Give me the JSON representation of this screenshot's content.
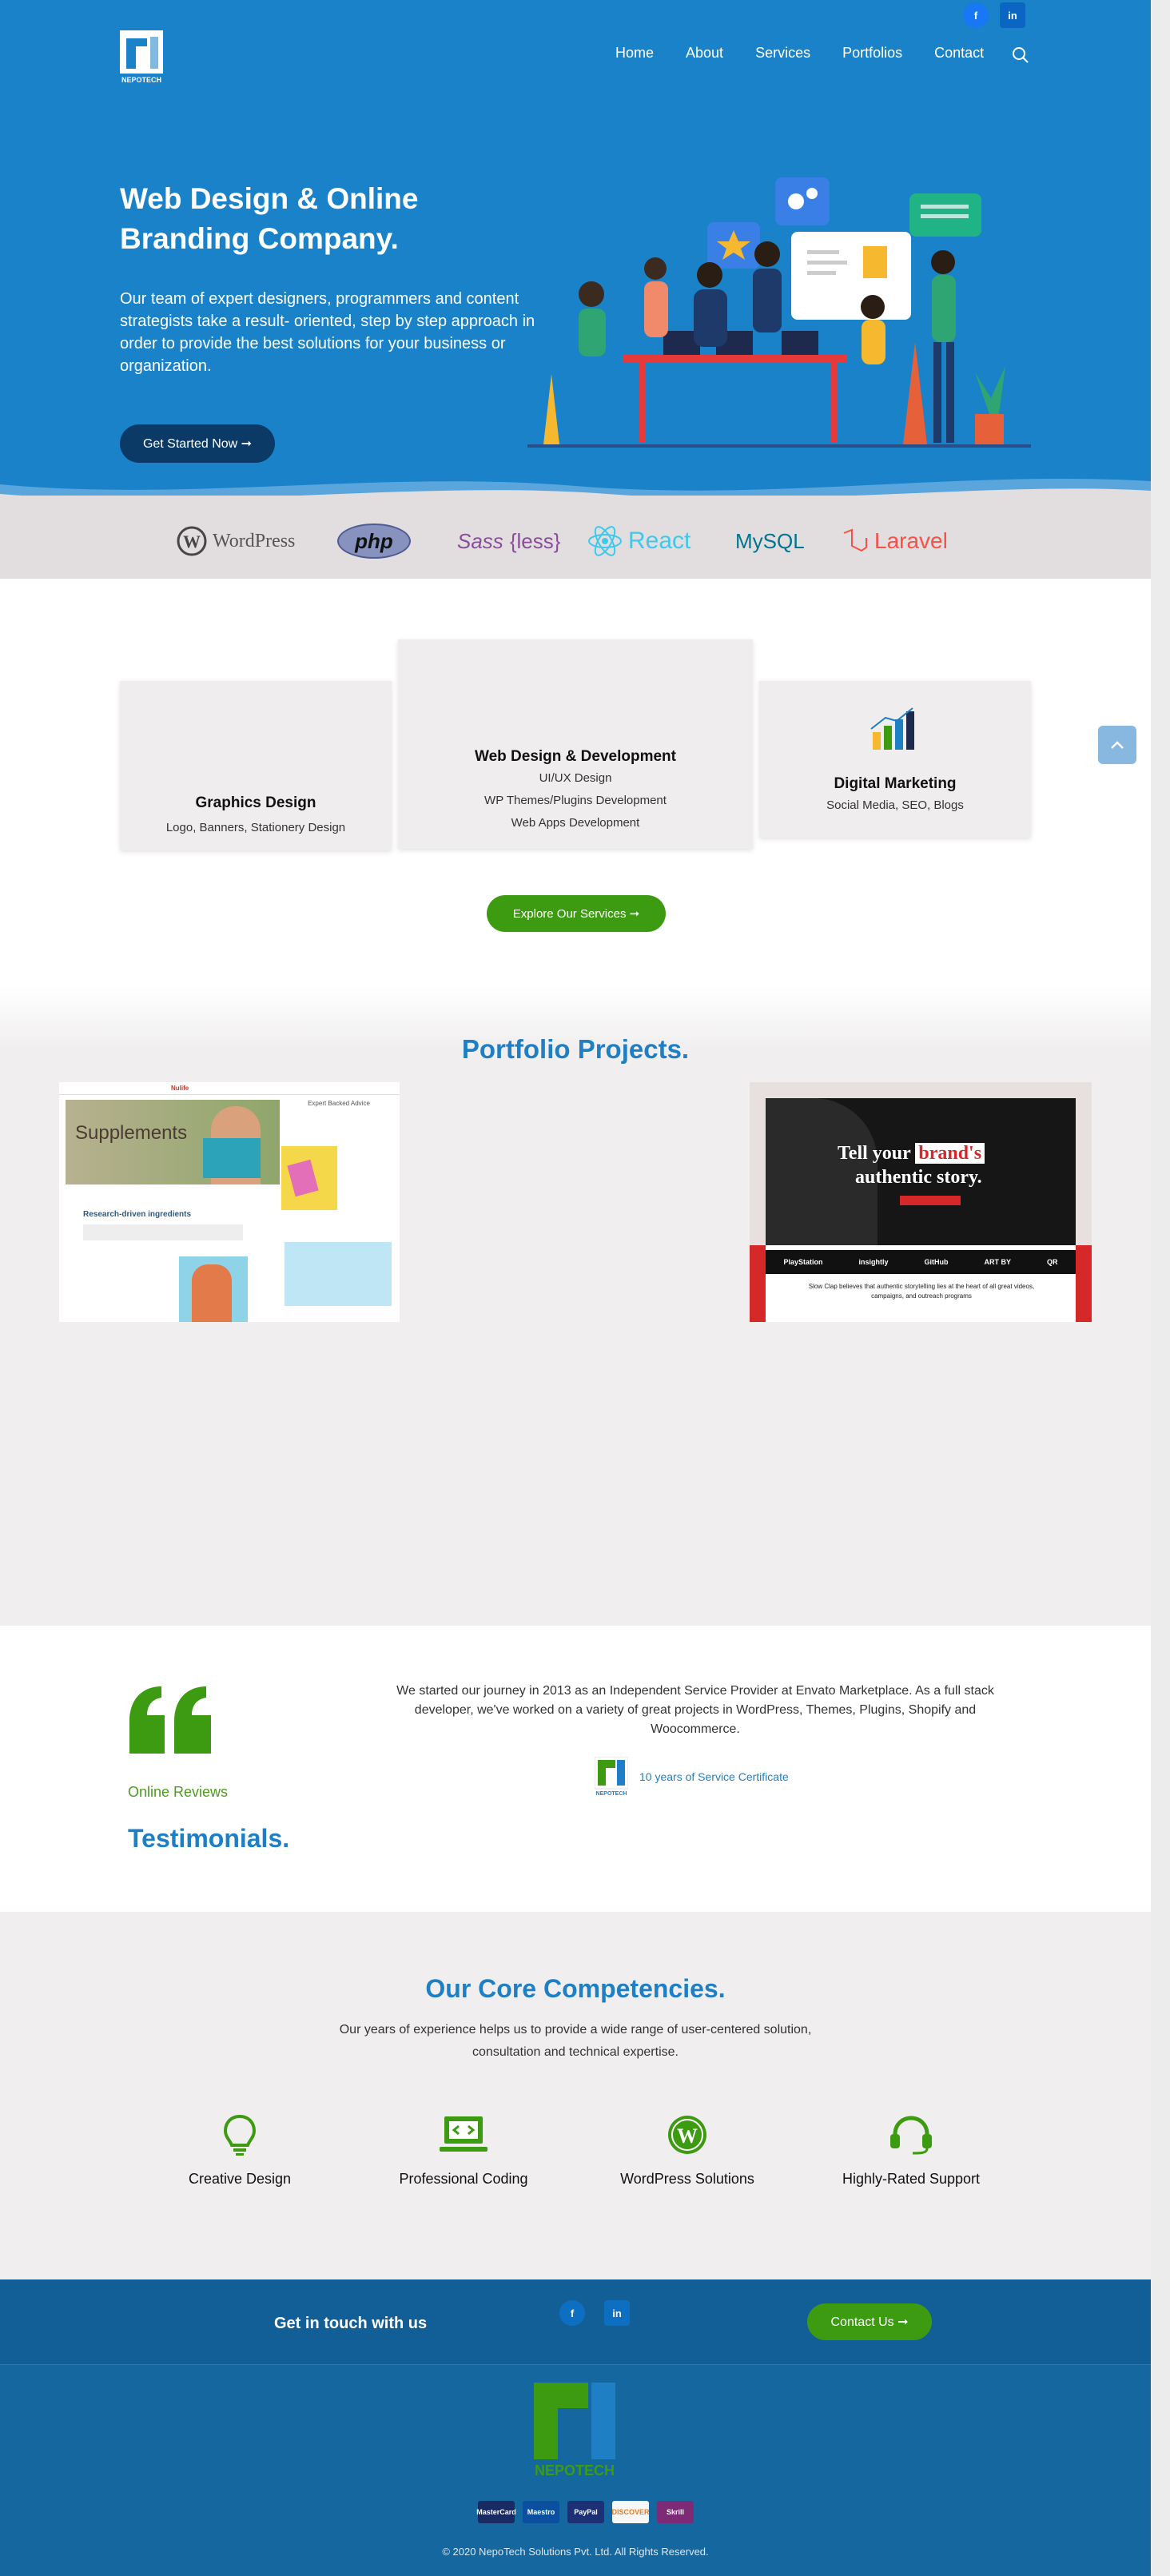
{
  "nav": {
    "items": [
      "Home",
      "About",
      "Services",
      "Portfolios",
      "Contact"
    ],
    "logo_text": "NEPOTECH"
  },
  "social": {
    "facebook": "f",
    "linkedin": "in"
  },
  "hero": {
    "title": "Web Design & Online Branding Company.",
    "text": "Our team of expert designers, programmers and content strategists take a result- oriented, step by step approach in order to provide the best solutions for your business or organization.",
    "button": "Get Started Now ➞"
  },
  "tech_logos": [
    "WordPress",
    "php",
    "Sass",
    "{less}",
    "React",
    "MySQL",
    "Laravel"
  ],
  "services": {
    "cards": [
      {
        "title": "Graphics Design",
        "lines": [
          "Logo, Banners, Stationery Design"
        ]
      },
      {
        "title": "Web Design & Development",
        "lines": [
          "UI/UX Design",
          "WP Themes/Plugins Development",
          "Web Apps Development"
        ]
      },
      {
        "title": "Digital Marketing",
        "lines": [
          "Social Media, SEO, Blogs"
        ]
      }
    ],
    "button": "Explore Our Services ➞"
  },
  "portfolio": {
    "title": "Portfolio Projects.",
    "item1": {
      "brand": "Nulife",
      "heading": "Supplements",
      "section": "Research-driven ingredients",
      "tag": "Expert Backed Advice"
    },
    "item2": {
      "line1a": "Tell your",
      "line1b": "brand's",
      "line2": "authentic story.",
      "sub": "Slow Clap believes that authentic storytelling lies at the heart of all great videos, campaigns, and outreach programs",
      "partners": [
        "PlayStation",
        "insightly",
        "GitHub",
        "ART BY",
        "QR"
      ]
    }
  },
  "testimonials": {
    "label": "Online Reviews",
    "title": "Testimonials.",
    "text": "We started our journey in 2013 as an Independent Service Provider at Envato Marketplace. As a full stack developer, we've worked on a variety of great projects in WordPress, Themes, Plugins, Shopify and Woocommerce.",
    "cert": "10 years of Service Certificate",
    "cert_logo_text": "NEPOTECH"
  },
  "competencies": {
    "title": "Our Core Competencies.",
    "lead": "Our years of experience helps us to provide a wide range of user-centered solution, consultation and technical expertise.",
    "items": [
      "Creative Design",
      "Professional Coding",
      "WordPress Solutions",
      "Highly-Rated Support"
    ]
  },
  "footer": {
    "get_in_touch": "Get in touch with us",
    "contact_button": "Contact Us ➞",
    "logo_text": "NEPOTECH",
    "payments": [
      "MasterCard",
      "Maestro",
      "PayPal",
      "DISCOVER",
      "Skrill"
    ],
    "copyright": "© 2020 NepoTech Solutions Pvt. Ltd. All Rights Reserved."
  },
  "colors": {
    "primary": "#1982c9",
    "accent_green": "#3d9b12",
    "heading_blue": "#1f7fc4",
    "footer_blue": "#14679f"
  }
}
